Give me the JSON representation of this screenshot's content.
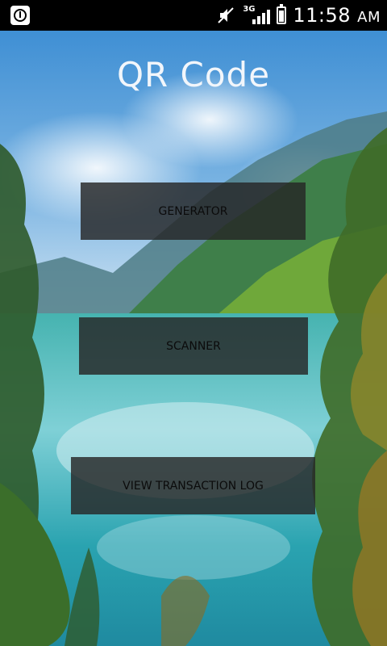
{
  "status_bar": {
    "network_label": "3G",
    "time": "11:58",
    "ampm": "AM"
  },
  "app": {
    "title": "QR Code"
  },
  "buttons": {
    "generator": "GENERATOR",
    "scanner": "SCANNER",
    "log": "VIEW TRANSACTION LOG"
  },
  "icons": {
    "notification": "info-badge-icon",
    "sound": "mute-icon",
    "signal": "signal-bars-icon",
    "battery": "battery-icon"
  }
}
